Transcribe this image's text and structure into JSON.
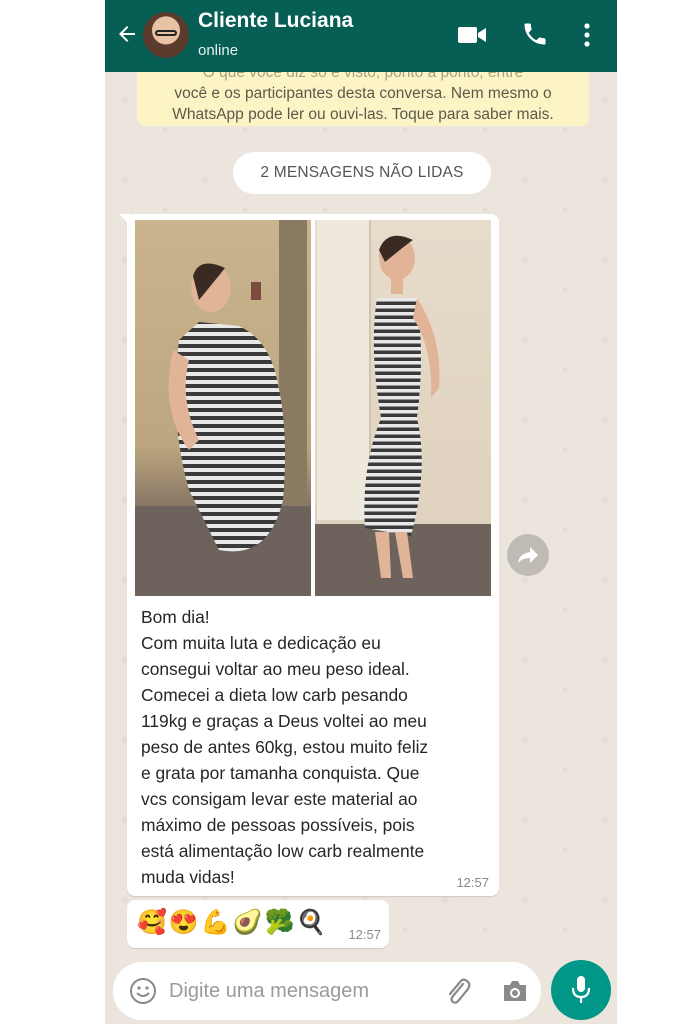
{
  "header": {
    "contact_name": "Cliente Luciana",
    "status": "online",
    "icons": [
      "back-arrow-icon",
      "video-call-icon",
      "phone-icon",
      "more-options-icon"
    ]
  },
  "notice": {
    "line1": "O que você diz só é visto, ponto a ponto, entre",
    "line2": "você e os participantes desta conversa. Nem mesmo o",
    "line3": "WhatsApp pode ler ou ouvi-las. Toque para saber mais."
  },
  "unread_label": "2 MENSAGENS NÃO LIDAS",
  "messages": [
    {
      "text_lines": [
        "Bom dia!",
        "Com muita luta e dedicação eu",
        "consegui voltar ao meu peso ideal.",
        "Comecei a dieta low carb pesando",
        "119kg e graças a Deus voltei ao meu",
        "peso de antes 60kg, estou muito feliz",
        "e grata por tamanha conquista. Que",
        "vcs consigam levar este material ao",
        "máximo de pessoas possíveis, pois",
        "está alimentação low carb realmente",
        "muda vidas!"
      ],
      "time": "12:57"
    },
    {
      "emojis": "🥰😍💪🥑🥦🍳",
      "time": "12:57"
    }
  ],
  "input": {
    "placeholder": "Digite uma mensagem"
  },
  "colors": {
    "header": "#075e54",
    "mic": "#009688",
    "chat_bg": "#ece5dd",
    "notice": "#fdf4c5"
  }
}
